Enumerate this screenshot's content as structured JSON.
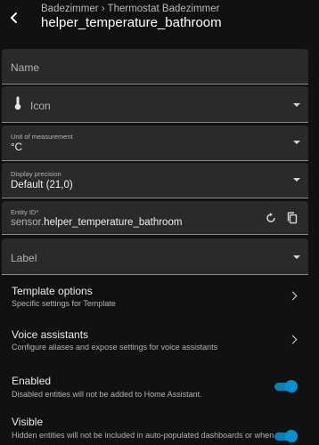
{
  "header": {
    "breadcrumb": "Badezimmer › Thermostat Badezimmer",
    "title": "helper_temperature_bathroom"
  },
  "fields": {
    "name": {
      "label": "Name"
    },
    "icon": {
      "label": "Icon"
    },
    "unit": {
      "label": "Unit of measurement",
      "value": "°C"
    },
    "precision": {
      "label": "Display precision",
      "value": "Default (21,0)"
    },
    "entity_id": {
      "label": "Entity ID*",
      "prefix": "sensor.",
      "value": "helper_temperature_bathroom"
    },
    "label": {
      "label": "Label"
    }
  },
  "rows": {
    "template": {
      "title": "Template options",
      "subtitle": "Specific settings for Template"
    },
    "voice": {
      "title": "Voice assistants",
      "subtitle": "Configure aliases and expose settings for voice assistants"
    },
    "enabled": {
      "title": "Enabled",
      "subtitle": "Disabled entities will not be added to Home Assistant.",
      "on": true
    },
    "visible": {
      "title": "Visible",
      "subtitle": "Hidden entities will not be included in auto-populated dashboards or when their",
      "on": true
    }
  },
  "colors": {
    "accent": "#0390d0",
    "background": "#111111",
    "field": "#2a2a2a"
  },
  "icons": {
    "back": "arrow-left-icon",
    "thermometer": "thermometer-icon",
    "restore": "restore-icon",
    "copy": "copy-icon"
  }
}
